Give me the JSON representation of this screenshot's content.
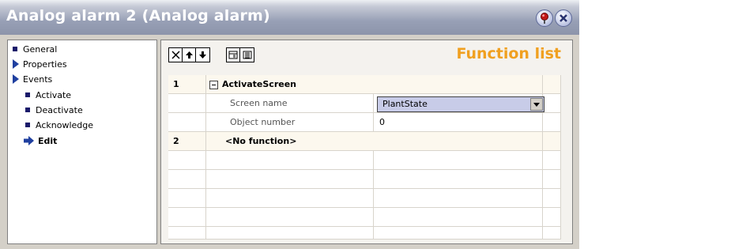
{
  "window": {
    "title": "Analog alarm 2 (Analog alarm)"
  },
  "title_buttons": {
    "help_icon": "pin-help-icon",
    "close_icon": "close-icon"
  },
  "tree": {
    "items": [
      {
        "label": "General",
        "icon": "square-bullet",
        "selected": false
      },
      {
        "label": "Properties",
        "icon": "expand-triangle",
        "selected": false
      },
      {
        "label": "Events",
        "icon": "expand-triangle",
        "selected": false
      },
      {
        "label": "Activate",
        "icon": "square-bullet",
        "selected": false
      },
      {
        "label": "Deactivate",
        "icon": "square-bullet",
        "selected": false
      },
      {
        "label": "Acknowledge",
        "icon": "square-bullet",
        "selected": false
      },
      {
        "label": "Edit",
        "icon": "arrow-right",
        "selected": true
      }
    ]
  },
  "toolbar": {
    "icons": [
      "delete-icon",
      "move-up-icon",
      "move-down-icon",
      "collapse-list-icon",
      "expand-list-icon"
    ]
  },
  "function_list": {
    "title": "Function list",
    "rows": [
      {
        "number": "1",
        "name": "ActivateScreen"
      },
      {
        "param_label": "Screen name",
        "value": "PlantState"
      },
      {
        "param_label": "Object number",
        "value": "0"
      },
      {
        "number": "2",
        "name": "<No function>"
      }
    ]
  },
  "colors": {
    "function_title": "#f0a020",
    "dropdown_bg": "#c8cce8",
    "tree_triangle": "#2040a0"
  }
}
